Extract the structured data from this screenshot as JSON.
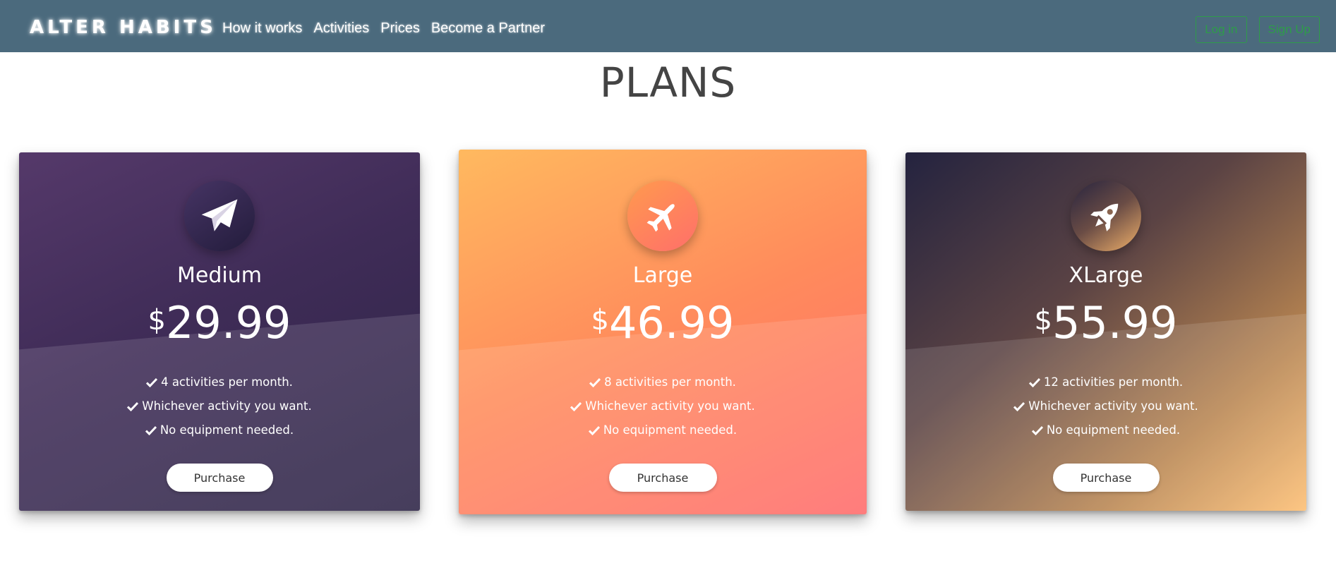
{
  "nav": {
    "brand": "ALTER HABITS",
    "links": [
      "How it works",
      "Activities",
      "Prices",
      "Become a Partner"
    ],
    "login_label": "Log in",
    "signup_label": "Sign Up"
  },
  "page": {
    "title": "PLANS"
  },
  "plans": [
    {
      "icon": "paper-plane-icon",
      "name": "Medium",
      "currency": "$",
      "price": "29.99",
      "features": [
        "4 activities per month.",
        "Whichever activity you want.",
        "No equipment needed."
      ],
      "button_label": "Purchase"
    },
    {
      "icon": "airplane-icon",
      "name": "Large",
      "currency": "$",
      "price": "46.99",
      "features": [
        "8 activities per month.",
        "Whichever activity you want.",
        "No equipment needed."
      ],
      "button_label": "Purchase"
    },
    {
      "icon": "rocket-icon",
      "name": "XLarge",
      "currency": "$",
      "price": "55.99",
      "features": [
        "12 activities per month.",
        "Whichever activity you want.",
        "No equipment needed."
      ],
      "button_label": "Purchase"
    }
  ],
  "colors": {
    "navbar": "#4b6a7d",
    "auth_accent": "#2e9c4a",
    "title": "#444444"
  }
}
